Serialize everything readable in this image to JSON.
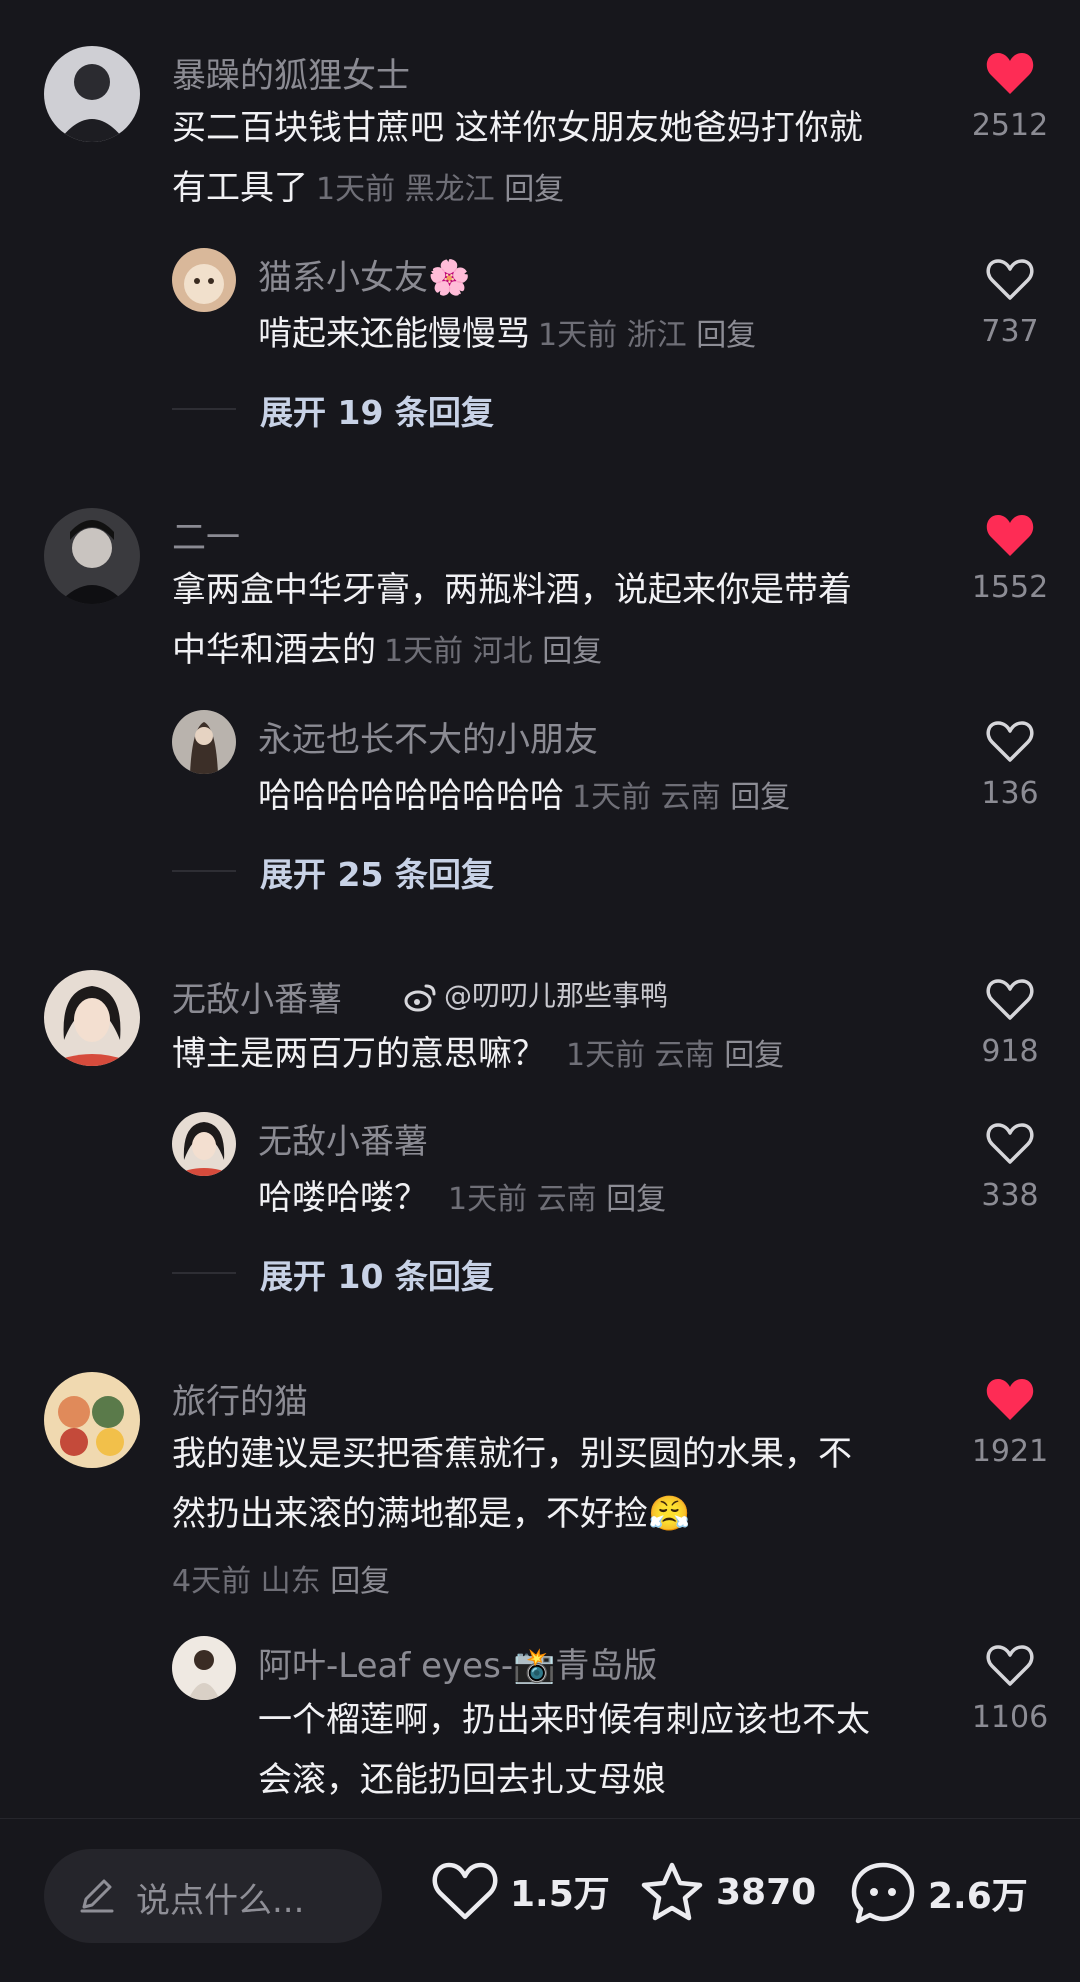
{
  "comments": [
    {
      "user": "暴躁的狐狸女士",
      "text_lines": [
        "买二百块钱甘蔗吧 这样你女朋友她爸妈打你就",
        "有工具了"
      ],
      "time": "1天前",
      "location": "黑龙江",
      "reply_label": "回复",
      "likes": "2512",
      "liked": true,
      "reply": {
        "user": "猫系小女友🌸",
        "text": "啃起来还能慢慢骂",
        "time": "1天前",
        "location": "浙江",
        "reply_label": "回复",
        "likes": "737"
      },
      "expand": "展开 19 条回复"
    },
    {
      "user": "二一",
      "text_lines": [
        "拿两盒中华牙膏，两瓶料酒，说起来你是带着",
        "中华和酒去的"
      ],
      "time": "1天前",
      "location": "河北",
      "reply_label": "回复",
      "likes": "1552",
      "liked": true,
      "reply": {
        "user": "永远也长不大的小朋友",
        "text": "哈哈哈哈哈哈哈哈哈",
        "time": "1天前",
        "location": "云南",
        "reply_label": "回复",
        "likes": "136"
      },
      "expand": "展开 25 条回复"
    },
    {
      "user": "无敌小番薯",
      "weibo_watermark": "@叨叨儿那些事鸭",
      "text_lines": [
        "博主是两百万的意思嘛？"
      ],
      "time": "1天前",
      "location": "云南",
      "reply_label": "回复",
      "likes": "918",
      "liked": false,
      "reply": {
        "user": "无敌小番薯",
        "text": "哈喽哈喽？",
        "time": "1天前",
        "location": "云南",
        "reply_label": "回复",
        "likes": "338"
      },
      "expand": "展开 10 条回复"
    },
    {
      "user": "旅行的猫",
      "text_lines": [
        "我的建议是买把香蕉就行，别买圆的水果，不",
        "然扔出来滚的满地都是，不好捡😤"
      ],
      "time": "4天前",
      "location": "山东",
      "reply_label": "回复",
      "likes": "1921",
      "liked": true,
      "reply": {
        "user": "阿叶-Leaf eyes-📸青岛版",
        "text_lines": [
          "一个榴莲啊，扔出来时候有刺应该也不太",
          "会滚，还能扔回去扎丈母娘"
        ],
        "likes": "1106"
      }
    }
  ],
  "bottom_bar": {
    "placeholder": "说点什么...",
    "likes": "1.5万",
    "favorites": "3870",
    "comments": "2.6万"
  },
  "colors": {
    "background": "#17171c",
    "liked_heart": "#fe2c55",
    "username": "#8b8b93",
    "meta": "#6f6f77"
  }
}
